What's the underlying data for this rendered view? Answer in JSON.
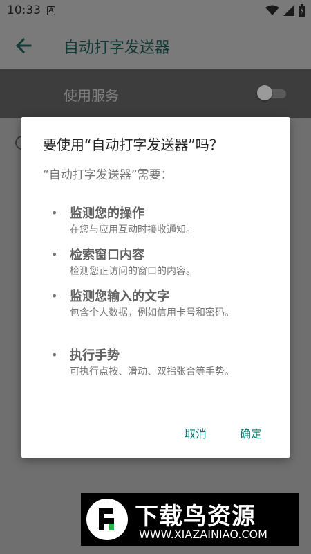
{
  "status_bar": {
    "time": "10:33",
    "notification_glyph": "A"
  },
  "app_bar": {
    "title": "自动打字发送器"
  },
  "settings": {
    "use_service_label": "使用服务",
    "switch_on": false
  },
  "dialog": {
    "title": "要使用“自动打字发送器”吗？",
    "subtitle": "“自动打字发送器”需要：",
    "bullet": "•",
    "permissions": [
      {
        "title": "监测您的操作",
        "description": "在您与应用互动时接收通知。"
      },
      {
        "title": "检索窗口内容",
        "description": "检测您正访问的窗口的内容。"
      },
      {
        "title": "监测您输入的文字",
        "description": "包含个人数据，例如信用卡号和密码。"
      },
      {
        "title": "执行手势",
        "description": "可执行点按、滑动、双指张合等手势。"
      }
    ],
    "cancel_label": "取消",
    "confirm_label": "确定"
  },
  "watermark": {
    "brand": "下载鸟资源",
    "url": "WWW.XIAZAINIAO.COM"
  },
  "colors": {
    "accent": "#00796b",
    "dialog_bg": "#ffffff",
    "scrim": "#6f6f6f"
  }
}
